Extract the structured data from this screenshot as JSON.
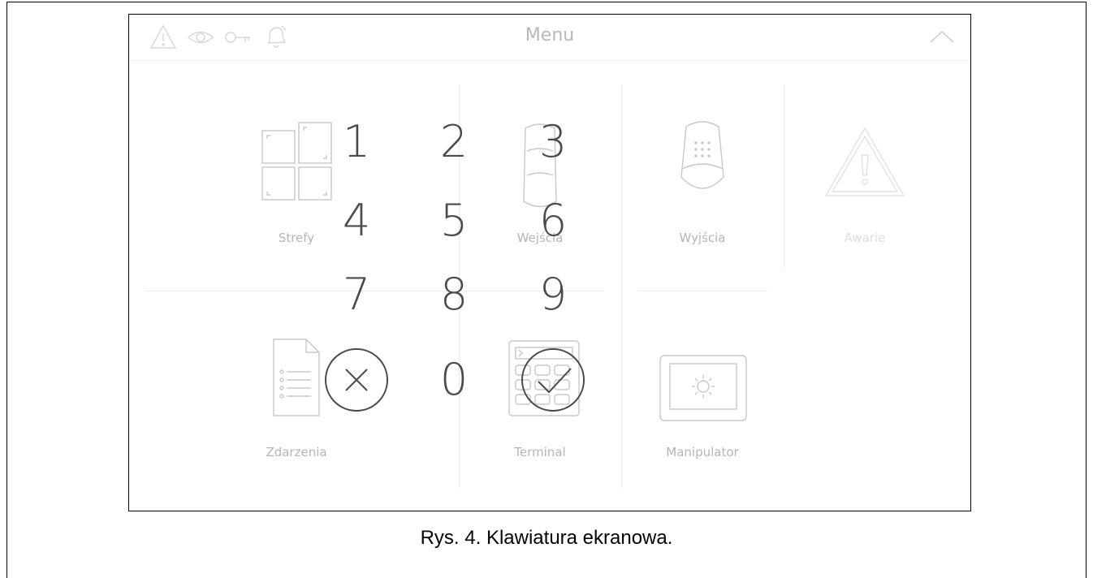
{
  "screen": {
    "title": "Menu",
    "status_icons": [
      "warning-triangle-icon",
      "eye-icon",
      "key-icon",
      "bell-icon"
    ],
    "collapse_icon": "chevron-up-icon"
  },
  "tiles": [
    {
      "label": "Strefy",
      "icon": "zones-icon"
    },
    {
      "label": "Wejścia",
      "icon": "detector-icon"
    },
    {
      "label": "Wyjścia",
      "icon": "siren-icon"
    },
    {
      "label": "Awarie",
      "icon": "warning-triangle-icon"
    },
    {
      "label": "Zdarzenia",
      "icon": "document-list-icon"
    },
    {
      "label": "Terminal",
      "icon": "keypad-icon"
    },
    {
      "label": "Manipulator",
      "icon": "gear-screen-icon"
    }
  ],
  "keypad": {
    "digits": [
      "1",
      "2",
      "3",
      "4",
      "5",
      "6",
      "7",
      "8",
      "9",
      "0"
    ],
    "cancel_icon": "cancel-circle-icon",
    "confirm_icon": "confirm-check-icon"
  },
  "caption": "Rys. 4. Klawiatura ekranowa.",
  "colors": {
    "keypad_text": "#4a4a4a",
    "faded_ui": "#c8c8c8",
    "frame": "#000000"
  }
}
